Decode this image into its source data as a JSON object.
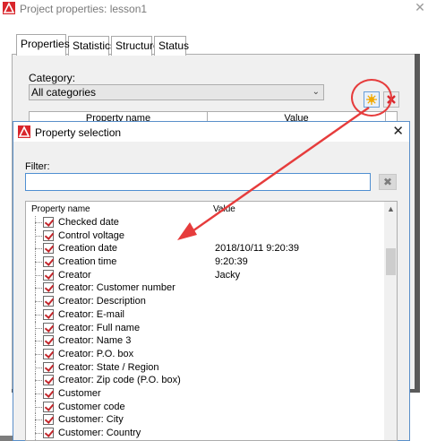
{
  "back_window": {
    "title": "Project properties: lesson1",
    "close_glyph": "✕",
    "tabs": [
      {
        "label": "Properties"
      },
      {
        "label": "Statistics"
      },
      {
        "label": "Structure"
      },
      {
        "label": "Status"
      }
    ],
    "category_label": "Category:",
    "category_value": "All categories",
    "new_property_icon": "new-property-icon",
    "delete_property_icon": "delete-icon",
    "grid_headers": [
      "Property name",
      "Value"
    ],
    "app_icon_color": "#d9262c"
  },
  "dialog": {
    "title": "Property selection",
    "close_glyph": "✕",
    "filter_label": "Filter:",
    "filter_value": "",
    "clear_glyph": "✖",
    "list_headers": {
      "name": "Property name",
      "value": "Value"
    },
    "rows": [
      {
        "name": "Checked date",
        "value": ""
      },
      {
        "name": "Control voltage",
        "value": ""
      },
      {
        "name": "Creation date",
        "value": "2018/10/11 9:20:39"
      },
      {
        "name": "Creation time",
        "value": "9:20:39"
      },
      {
        "name": "Creator",
        "value": "Jacky"
      },
      {
        "name": "Creator: Customer number",
        "value": ""
      },
      {
        "name": "Creator: Description",
        "value": ""
      },
      {
        "name": "Creator: E-mail",
        "value": ""
      },
      {
        "name": "Creator: Full name",
        "value": ""
      },
      {
        "name": "Creator: Name 3",
        "value": ""
      },
      {
        "name": "Creator: P.O. box",
        "value": ""
      },
      {
        "name": "Creator: State / Region",
        "value": ""
      },
      {
        "name": "Creator: Zip code (P.O. box)",
        "value": ""
      },
      {
        "name": "Customer",
        "value": ""
      },
      {
        "name": "Customer code",
        "value": ""
      },
      {
        "name": "Customer: City",
        "value": ""
      },
      {
        "name": "Customer: Country",
        "value": ""
      }
    ]
  },
  "colors": {
    "annotation_red": "#e63c3c",
    "check_red": "#c3262b",
    "focus_blue": "#4f8fd1"
  }
}
